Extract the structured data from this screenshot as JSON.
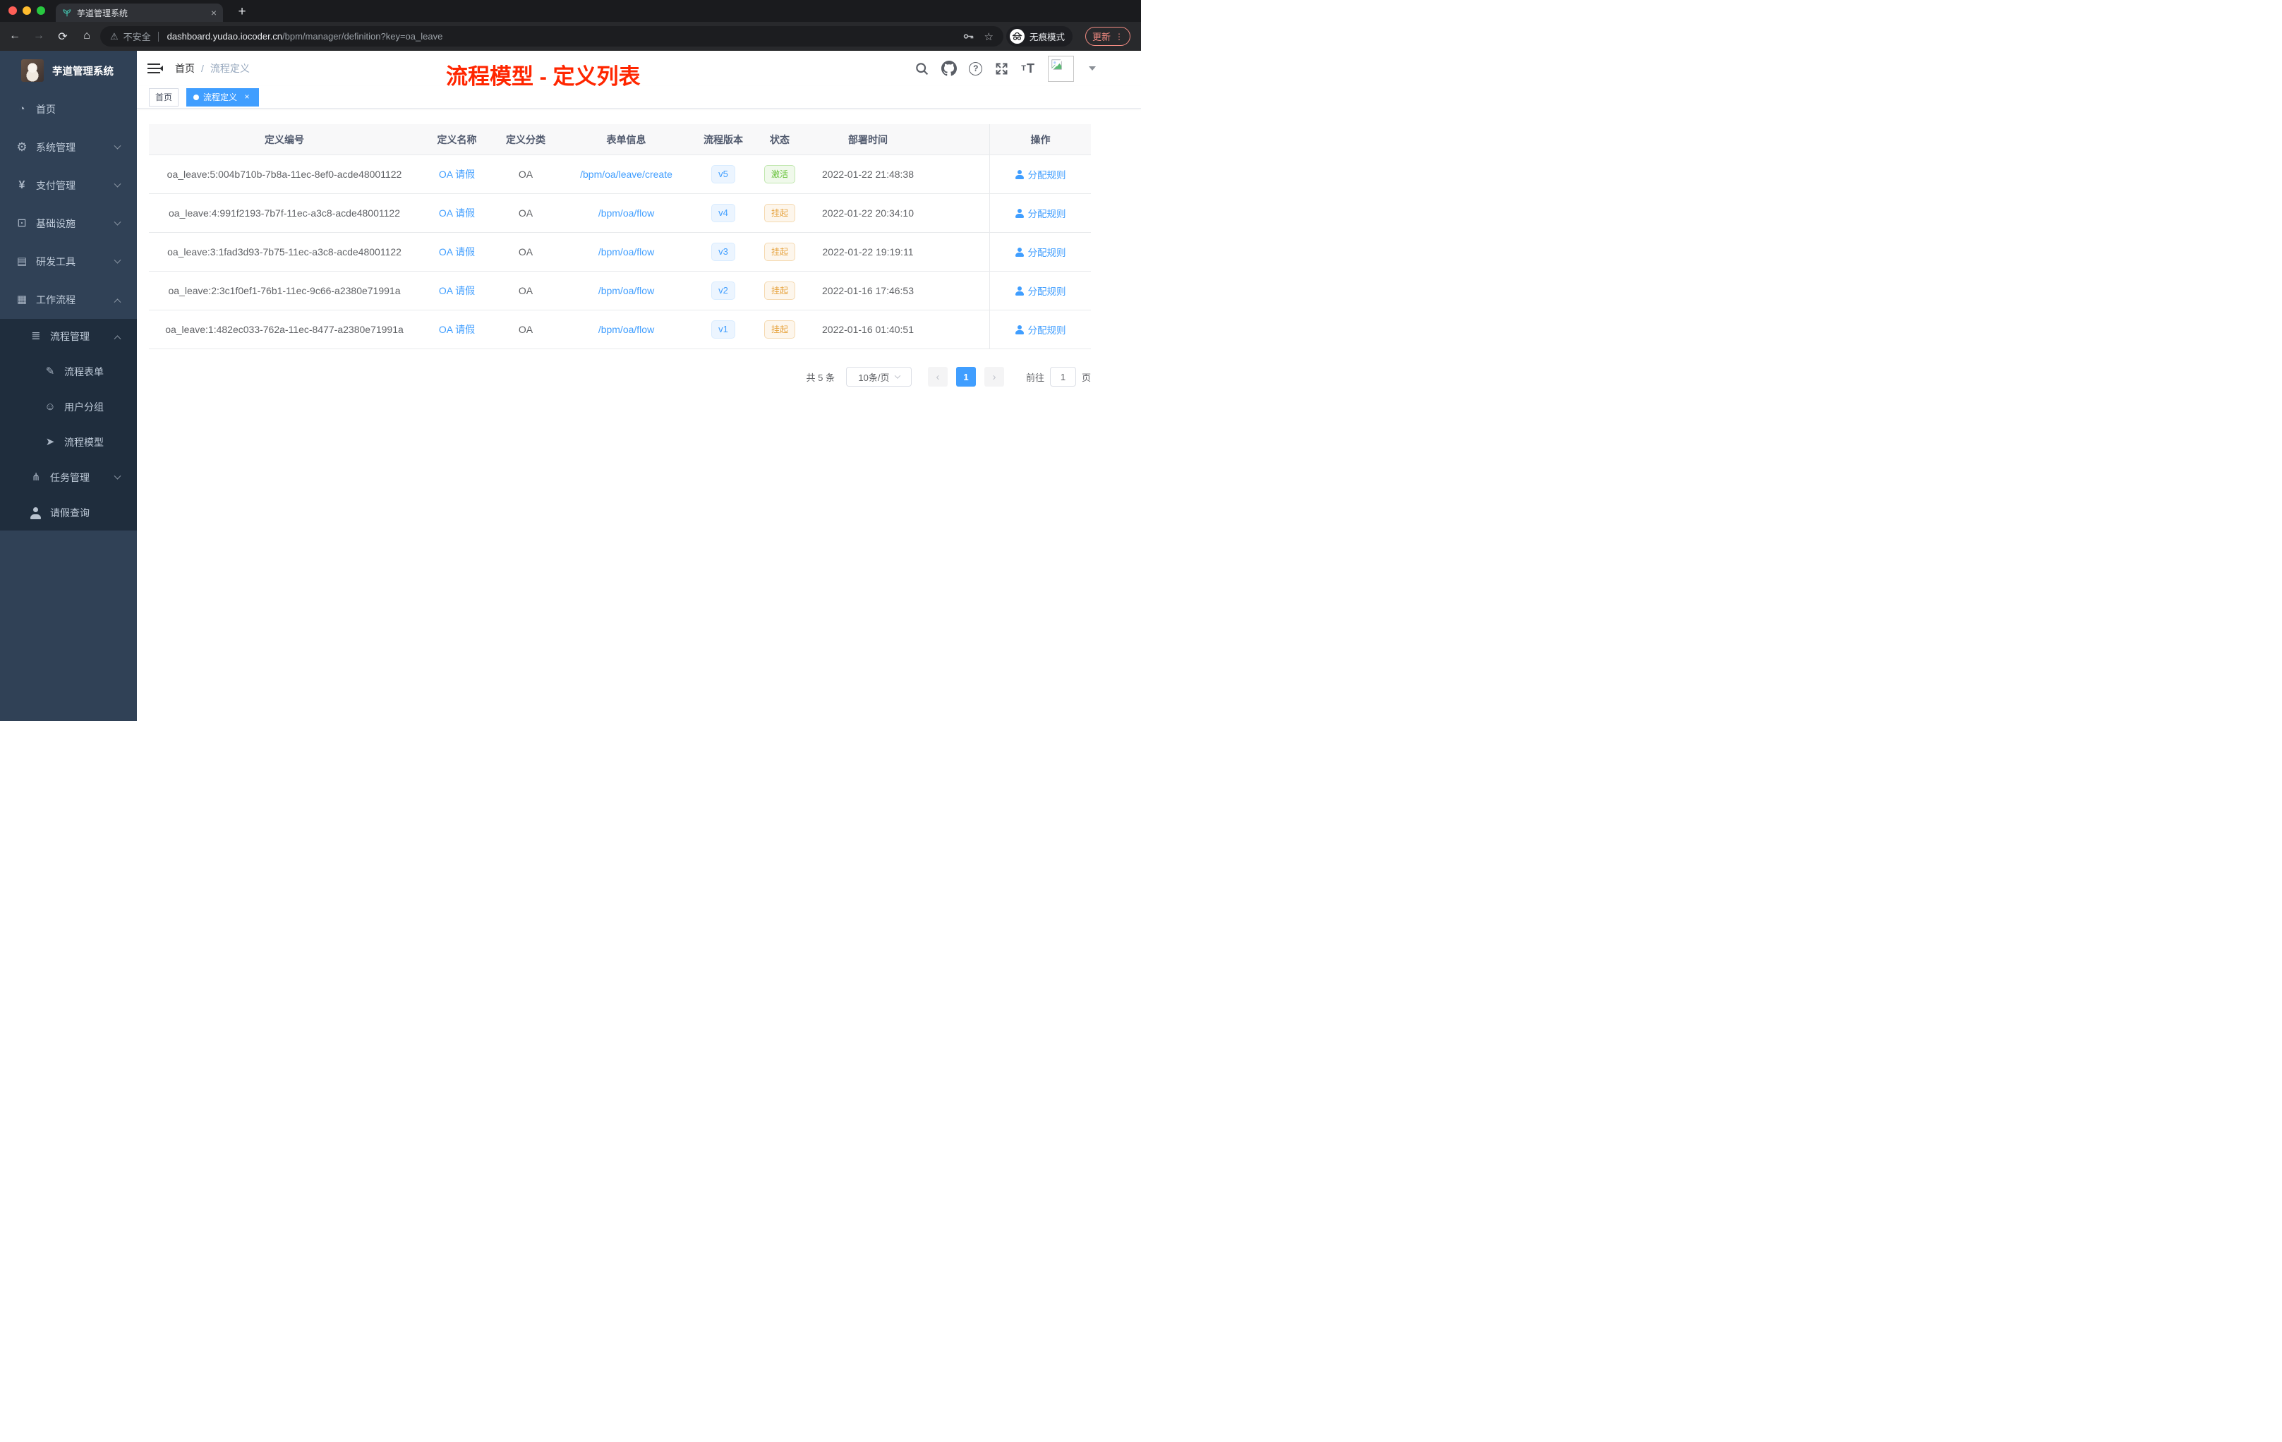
{
  "colors": {
    "accent": "#409eff",
    "annotation_red": "#ff2600",
    "success": "#67c23a",
    "warning": "#e6a23c",
    "sidebar_bg": "#304156",
    "sidebar_sub_bg": "#1f2d3d"
  },
  "browser": {
    "tab_title": "芋道管理系统",
    "new_tab": "+",
    "security_label": "不安全",
    "url_host": "dashboard.yudao.iocoder.cn",
    "url_path": "/bpm/manager/definition?key=oa_leave",
    "incognito_label": "无痕模式",
    "update_label": "更新"
  },
  "sidebar": {
    "logo_title": "芋道管理系统",
    "items": [
      {
        "label": "首页",
        "icon": "dashboard",
        "level": "root",
        "arrow": "none"
      },
      {
        "label": "系统管理",
        "icon": "gear",
        "level": "root",
        "arrow": "down"
      },
      {
        "label": "支付管理",
        "icon": "yen",
        "level": "root",
        "arrow": "down"
      },
      {
        "label": "基础设施",
        "icon": "monitor",
        "level": "root",
        "arrow": "down"
      },
      {
        "label": "研发工具",
        "icon": "toolbox",
        "level": "root",
        "arrow": "down"
      },
      {
        "label": "工作流程",
        "icon": "briefcase",
        "level": "root",
        "arrow": "up"
      },
      {
        "label": "流程管理",
        "icon": "list",
        "level": "sub",
        "arrow": "up"
      },
      {
        "label": "流程表单",
        "icon": "form",
        "level": "subsub",
        "arrow": "none"
      },
      {
        "label": "用户分组",
        "icon": "robot",
        "level": "subsub",
        "arrow": "none"
      },
      {
        "label": "流程模型",
        "icon": "send",
        "level": "subsub",
        "arrow": "none"
      },
      {
        "label": "任务管理",
        "icon": "tree",
        "level": "sub",
        "arrow": "down"
      },
      {
        "label": "请假查询",
        "icon": "user",
        "level": "sub",
        "arrow": "none"
      }
    ]
  },
  "header": {
    "breadcrumb": {
      "home": "首页",
      "separator": "/",
      "current": "流程定义"
    },
    "annotation": "流程模型 - 定义列表"
  },
  "tags": {
    "home": "首页",
    "active": "流程定义"
  },
  "table": {
    "columns": [
      "定义编号",
      "定义名称",
      "定义分类",
      "表单信息",
      "流程版本",
      "状态",
      "部署时间",
      "操作"
    ],
    "rows": [
      {
        "id": "oa_leave:5:004b710b-7b8a-11ec-8ef0-acde48001122",
        "name": "OA 请假",
        "category": "OA",
        "form": "/bpm/oa/leave/create",
        "version": "v5",
        "status": {
          "text": "激活",
          "type": "success"
        },
        "time": "2022-01-22 21:48:38",
        "action": "分配规则"
      },
      {
        "id": "oa_leave:4:991f2193-7b7f-11ec-a3c8-acde48001122",
        "name": "OA 请假",
        "category": "OA",
        "form": "/bpm/oa/flow",
        "version": "v4",
        "status": {
          "text": "挂起",
          "type": "warning"
        },
        "time": "2022-01-22 20:34:10",
        "action": "分配规则"
      },
      {
        "id": "oa_leave:3:1fad3d93-7b75-11ec-a3c8-acde48001122",
        "name": "OA 请假",
        "category": "OA",
        "form": "/bpm/oa/flow",
        "version": "v3",
        "status": {
          "text": "挂起",
          "type": "warning"
        },
        "time": "2022-01-22 19:19:11",
        "action": "分配规则"
      },
      {
        "id": "oa_leave:2:3c1f0ef1-76b1-11ec-9c66-a2380e71991a",
        "name": "OA 请假",
        "category": "OA",
        "form": "/bpm/oa/flow",
        "version": "v2",
        "status": {
          "text": "挂起",
          "type": "warning"
        },
        "time": "2022-01-16 17:46:53",
        "action": "分配规则"
      },
      {
        "id": "oa_leave:1:482ec033-762a-11ec-8477-a2380e71991a",
        "name": "OA 请假",
        "category": "OA",
        "form": "/bpm/oa/flow",
        "version": "v1",
        "status": {
          "text": "挂起",
          "type": "warning"
        },
        "time": "2022-01-16 01:40:51",
        "action": "分配规则"
      }
    ]
  },
  "pagination": {
    "total": "共 5 条",
    "page_size": "10条/页",
    "current_page": "1",
    "goto_label": "前往",
    "goto_value": "1",
    "goto_suffix": "页"
  }
}
